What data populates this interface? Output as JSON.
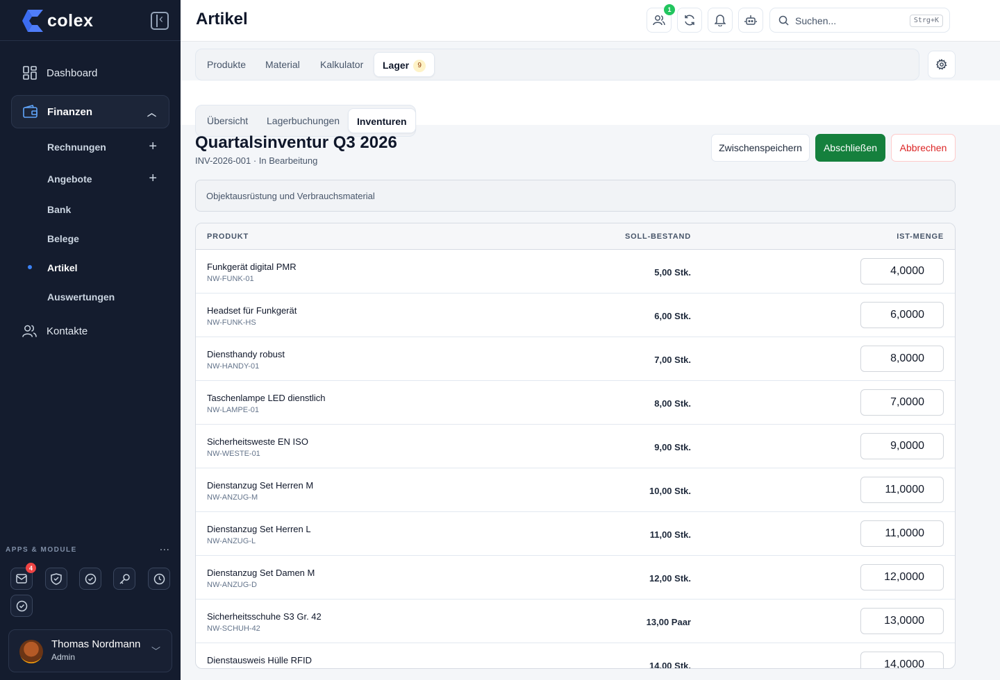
{
  "sidebar": {
    "logo_text": "colex",
    "nav": [
      {
        "label": "Dashboard",
        "icon": "dashboard-icon"
      },
      {
        "label": "Finanzen",
        "icon": "wallet-icon"
      },
      {
        "label": "Kontakte",
        "icon": "users-icon"
      }
    ],
    "sub_items": [
      {
        "label": "Rechnungen"
      },
      {
        "label": "Angebote"
      },
      {
        "label": "Bank"
      },
      {
        "label": "Belege"
      },
      {
        "label": "Artikel"
      },
      {
        "label": "Auswertungen"
      }
    ],
    "apps_label": "APPS & MODULE",
    "apps_more": "...",
    "mail_badge": "4",
    "user": {
      "name": "Thomas Nordmann",
      "role": "Admin"
    }
  },
  "header": {
    "title": "Artikel",
    "team_badge": "1",
    "search_placeholder": "Suchen...",
    "search_shortcut": "Strg+K"
  },
  "tabs": {
    "primary": [
      {
        "label": "Produkte"
      },
      {
        "label": "Material"
      },
      {
        "label": "Kalkulator"
      },
      {
        "label": "Lager",
        "badge": "9"
      }
    ],
    "secondary": [
      {
        "label": "Übersicht"
      },
      {
        "label": "Lagerbuchungen"
      },
      {
        "label": "Inventuren"
      }
    ]
  },
  "inventory": {
    "title": "Quartalsinventur Q3 2026",
    "subtitle": "INV-2026-001 · In Bearbeitung",
    "description": "Objektausrüstung und Verbrauchsmaterial",
    "buttons": {
      "save": "Zwischenspeichern",
      "finish": "Abschließen",
      "cancel": "Abbrechen"
    },
    "columns": {
      "product": "PRODUKT",
      "target": "SOLL-BESTAND",
      "actual": "IST-MENGE"
    },
    "rows": [
      {
        "name": "Funkgerät digital PMR",
        "sku": "NW-FUNK-01",
        "target": "5,00 Stk.",
        "actual": "4,0000"
      },
      {
        "name": "Headset für Funkgerät",
        "sku": "NW-FUNK-HS",
        "target": "6,00 Stk.",
        "actual": "6,0000"
      },
      {
        "name": "Diensthandy robust",
        "sku": "NW-HANDY-01",
        "target": "7,00 Stk.",
        "actual": "8,0000"
      },
      {
        "name": "Taschenlampe LED dienstlich",
        "sku": "NW-LAMPE-01",
        "target": "8,00 Stk.",
        "actual": "7,0000"
      },
      {
        "name": "Sicherheitsweste EN ISO",
        "sku": "NW-WESTE-01",
        "target": "9,00 Stk.",
        "actual": "9,0000"
      },
      {
        "name": "Dienstanzug Set Herren M",
        "sku": "NW-ANZUG-M",
        "target": "10,00 Stk.",
        "actual": "11,0000"
      },
      {
        "name": "Dienstanzug Set Herren L",
        "sku": "NW-ANZUG-L",
        "target": "11,00 Stk.",
        "actual": "11,0000"
      },
      {
        "name": "Dienstanzug Set Damen M",
        "sku": "NW-ANZUG-D",
        "target": "12,00 Stk.",
        "actual": "12,0000"
      },
      {
        "name": "Sicherheitsschuhe S3 Gr. 42",
        "sku": "NW-SCHUH-42",
        "target": "13,00 Paar",
        "actual": "13,0000"
      },
      {
        "name": "Dienstausweis Hülle RFID",
        "sku": "",
        "target": "14,00 Stk.",
        "actual": "14,0000"
      }
    ]
  }
}
